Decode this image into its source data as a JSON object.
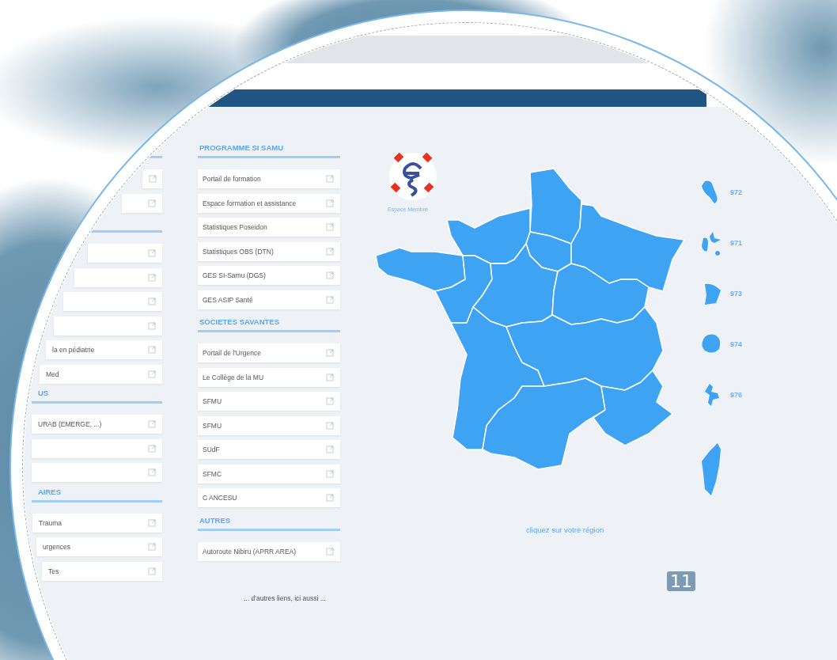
{
  "slide_number": "11",
  "left_column": [
    {
      "items": [
        {
          "kind": "link"
        },
        {
          "kind": "link"
        }
      ]
    },
    {
      "items": [
        {
          "kind": "link"
        },
        {
          "kind": "link"
        },
        {
          "kind": "link"
        },
        {
          "kind": "link"
        },
        {
          "kind": "link",
          "label": "la en pédiatrie"
        },
        {
          "kind": "link",
          "label": "Med"
        }
      ]
    },
    {
      "heading": "US",
      "items": [
        {
          "kind": "link",
          "label": "URAB (EMERGE, ...)"
        },
        {
          "kind": "link"
        },
        {
          "kind": "link"
        }
      ]
    },
    {
      "heading": "AIRES",
      "items": [
        {
          "kind": "link",
          "label": "Trauma"
        },
        {
          "kind": "link",
          "label": "urgences"
        },
        {
          "kind": "link",
          "label": "Tes"
        }
      ]
    }
  ],
  "middle_column": [
    {
      "heading": "PROGRAMME SI SAMU",
      "items": [
        {
          "kind": "link",
          "label": "Portail de formation"
        },
        {
          "kind": "link",
          "label": "Espace formation et assistance"
        },
        {
          "kind": "link",
          "label": "Statistiques Poseidon"
        },
        {
          "kind": "link",
          "label": "Statistiques OBS (DTN)"
        },
        {
          "kind": "link",
          "label": "GES SI-Samu (DGS)"
        },
        {
          "kind": "link",
          "label": "GES ASIP Santé"
        }
      ]
    },
    {
      "heading": "SOCIETES SAVANTES",
      "items": [
        {
          "kind": "link",
          "label": "Portail de l'Urgence"
        },
        {
          "kind": "link",
          "label": "Le Collège de la MU"
        },
        {
          "kind": "link",
          "label": "SFMU"
        },
        {
          "kind": "link",
          "label": "SFMU"
        },
        {
          "kind": "link",
          "label": "SUdF"
        },
        {
          "kind": "link",
          "label": "SFMC"
        },
        {
          "kind": "link",
          "label": "C ANCESU"
        }
      ]
    },
    {
      "heading": "AUTRES",
      "items": [
        {
          "kind": "link",
          "label": "Autoroute Nibiru (APRR AREA)"
        }
      ]
    }
  ],
  "more_links": "... d'autres liens, ici aussi ...",
  "logo_caption": "Espace Membre",
  "overseas": [
    {
      "code": "972"
    },
    {
      "code": "971"
    },
    {
      "code": "973"
    },
    {
      "code": "974"
    },
    {
      "code": "976"
    }
  ],
  "map_hint": "cliquez sur votre région"
}
